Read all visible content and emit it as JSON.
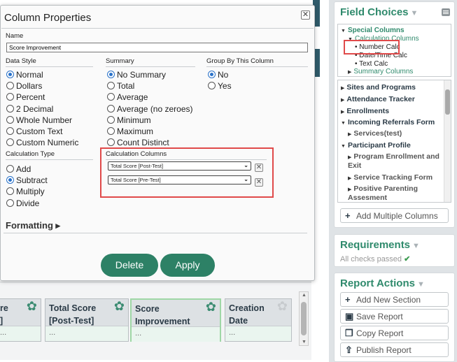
{
  "dialog": {
    "title": "Column Properties",
    "name_label": "Name",
    "name_value": "Score Improvement",
    "data_style": {
      "label": "Data Style",
      "options": [
        "Normal",
        "Dollars",
        "Percent",
        "2 Decimal",
        "Whole Number",
        "Custom Text",
        "Custom Numeric"
      ],
      "selected": "Normal"
    },
    "summary": {
      "label": "Summary",
      "options": [
        "No Summary",
        "Total",
        "Average",
        "Average (no zeroes)",
        "Minimum",
        "Maximum",
        "Count Distinct"
      ],
      "selected": "No Summary"
    },
    "group_by": {
      "label": "Group By This Column",
      "options": [
        "No",
        "Yes"
      ],
      "selected": "No"
    },
    "calculation_type": {
      "label": "Calculation Type",
      "options": [
        "Add",
        "Subtract",
        "Multiply",
        "Divide"
      ],
      "selected": "Subtract"
    },
    "calculation_columns": {
      "label": "Calculation Columns",
      "selects": [
        "Total Score [Post-Test]",
        "Total Score [Pre-Test]"
      ]
    },
    "formatting_label": "Formatting ▸",
    "delete_label": "Delete",
    "apply_label": "Apply"
  },
  "report_columns": [
    {
      "line1": "re",
      "line2": "]",
      "cell": "..."
    },
    {
      "line1": "Total Score",
      "line2": "[Post-Test]",
      "cell": "..."
    },
    {
      "line1": "Score",
      "line2": "Improvement",
      "cell": "..."
    },
    {
      "line1": "Creation",
      "line2": "Date",
      "cell": "..."
    }
  ],
  "field_choices": {
    "title": "Field Choices",
    "special_columns": "Special Columns",
    "calculation_columns": "Calculation Columns",
    "number_calc": "• Number Calc",
    "date_time_calc": "• Date/Time Calc",
    "text_calc": "• Text Calc",
    "summary_columns": "Summary Columns",
    "sections": [
      "Sites and Programs",
      "Attendance Tracker",
      "Enrollments",
      "Incoming Referrals Form"
    ],
    "services": "Services(test)",
    "participant_profile": "Participant Profile",
    "program_enrollment_1": "Program Enrollment and",
    "program_enrollment_2": "Exit",
    "service_tracking": "Service Tracking Form",
    "positive_parenting_1": "Positive Parenting",
    "positive_parenting_2": "Assesment",
    "add_multiple": "Add Multiple Columns"
  },
  "requirements": {
    "title": "Requirements",
    "status": "All checks passed"
  },
  "report_actions": {
    "title": "Report Actions",
    "buttons": [
      "Add New Section",
      "Save Report",
      "Copy Report",
      "Publish Report"
    ]
  },
  "colors": {
    "accent_green": "#2f8a6c",
    "button_green": "#2d8166",
    "highlight_red": "#e04a4a",
    "radio_blue": "#2a72c9"
  }
}
